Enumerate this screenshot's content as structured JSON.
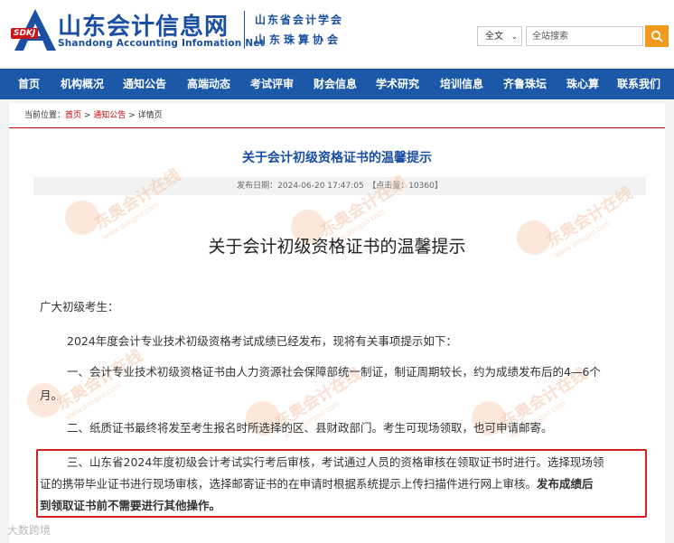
{
  "header": {
    "badge": "SDKJ",
    "site_title": "山东会计信息网",
    "site_en": "Shandong Accounting Infomation Net",
    "org_line1": "山东省会计学会",
    "org_line2": "山东珠算协会",
    "search_scope": "全文",
    "search_placeholder": "全站搜索",
    "accent_color": "#1a4fa3",
    "search_button_color": "#f39a1e"
  },
  "nav": {
    "items": [
      "首页",
      "机构概况",
      "通知公告",
      "高端动态",
      "考试评审",
      "财会信息",
      "学术研究",
      "培训信息",
      "齐鲁珠坛",
      "珠心算",
      "联系我们"
    ],
    "bg_color": "#1b58a8"
  },
  "breadcrumb": {
    "prefix": "当前位置：",
    "home": "首页",
    "sep1": " > ",
    "section": "通知公告",
    "sep2": " > ",
    "current": "详情页"
  },
  "article": {
    "title": "关于会计初级资格证书的温馨提示",
    "meta": "发布日期：2024-06-20 17:47:05　【点击量：10360】",
    "doc_title": "关于会计初级资格证书的温馨提示",
    "greeting": "广大初级考生：",
    "p_intro": "2024年度会计专业技术初级资格考试成绩已经发布，现将有关事项提示如下：",
    "p1_line1": "一、会计专业技术初级资格证书由人力资源社会保障部统一制证，制证周期较长，约为成绩发布后的4—6个",
    "p1_line2": "月。",
    "p2": "二、纸质证书最终将发至考生报名时所选择的区、县财政部门。考生可现场领取，也可申请邮寄。",
    "p3_line1": "三、山东省2024年度初级会计考试实行考后审核，考试通过人员的资格审核在领取证书时进行。选择现场领",
    "p3_line2": "证的携带毕业证书进行现场审核，选择邮寄证书的在申请时根据系统提示上传扫描件进行网上审核。",
    "p3_bold1": "发布成绩后",
    "p3_bold2": "到领取证书前不需要进行其他操作。"
  },
  "watermark": {
    "text": "东奥会计在线",
    "url": "www.dongao.com"
  },
  "corner_watermark": "大数跨境"
}
